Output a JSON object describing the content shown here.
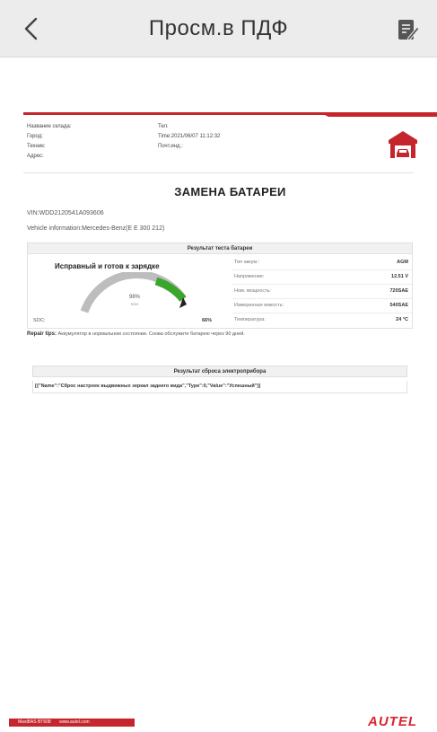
{
  "header": {
    "title": "Просм.в ПДФ",
    "back_icon": "chevron-left-icon",
    "edit_icon": "edit-icon"
  },
  "report": {
    "accent_color": "#c5252c",
    "info_left": [
      "Название склада:",
      "Город:",
      "Техник:",
      "Адрес:"
    ],
    "info_mid": [
      "Тел:",
      "Time:2021/06/07 11:12:32",
      "Почт.инд.:"
    ],
    "title": "ЗАМЕНА БАТАРЕИ",
    "vin": "VIN:WDD2120541A093606",
    "vehicle": "Vehicle information:Mercedes-Benz(E   E 300 212)",
    "battery_section": "Результат теста батареи",
    "status": "Исправный и готов к зарядке",
    "gauge_value": "98%",
    "gauge_unit": "SOH",
    "gauge_fraction": 0.98,
    "soc_label": "SOC:",
    "soc_value": "66%",
    "params": [
      {
        "k": "Тип аккум.:",
        "v": "AGM"
      },
      {
        "k": "Напряжение:",
        "v": "12.51 V"
      },
      {
        "k": "Ном. мощность:",
        "v": "720SAE"
      },
      {
        "k": "Измеренная емкость:",
        "v": "540SAE"
      },
      {
        "k": "Температура:",
        "v": "24 °C"
      }
    ],
    "tips_label": "Repair tips:",
    "tips_text": "Аккумулятор в нормальном состоянии. Снова обслужите батарею через 90 дней.",
    "reset_section": "Результат сброса электроприбора",
    "reset_text": "[{\"Name\":\"Сброс настроек выдвижных зеркал заднего вида\",\"Type\":0,\"Value\":\"Успешный\"}]"
  },
  "footer": {
    "model": "MaxiBAS BT608",
    "site": "www.autel.com",
    "brand": "AUTEL"
  }
}
